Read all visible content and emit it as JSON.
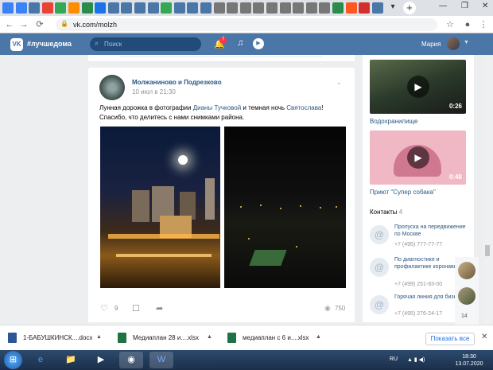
{
  "browser": {
    "url": "vk.com/molzh",
    "new_tab": "+",
    "tab_dropdown": "▾",
    "window_buttons": {
      "minimize": "—",
      "maximize": "❐",
      "close": "✕"
    },
    "tab_colors": [
      "#3b82f6",
      "#3b82f6",
      "#4a76a8",
      "#ea4335",
      "#34a853",
      "#ff8c00",
      "#2a8c4a",
      "#1a73e8",
      "#4a76a8",
      "#4a76a8",
      "#4a76a8",
      "#4a76a8",
      "#34a853",
      "#4a76a8",
      "#4a76a8",
      "#4a76a8",
      "#777777",
      "#777777",
      "#777777",
      "#777777",
      "#777777",
      "#777777",
      "#777777",
      "#777777",
      "#777777",
      "#2a8c4a",
      "#ff5722",
      "#d32f2f",
      "#4a76a8"
    ]
  },
  "vk_header": {
    "logo": "VK",
    "hashtag": "#лучшедома",
    "search_placeholder": "Поиск",
    "notifications_count": "7",
    "user_name": "Мария"
  },
  "post": {
    "group_name": "Молжаниново и Подрезково",
    "date": "10 июл в 21:30",
    "text_before": "Лунная дорожка в фотографии ",
    "author_link": "Дианы Тучковой",
    "text_mid": " и темная ночь ",
    "author_link2": "Святослава",
    "text_after": "! Спасибо, что делитесь с нами снимками района.",
    "likes": "9",
    "views": "750"
  },
  "sidebar": {
    "videos": [
      {
        "title": "Водохранилище",
        "duration": "0:26"
      },
      {
        "title": "Приют \"Супер собака\"",
        "duration": "0:48"
      }
    ],
    "contacts_title": "Контакты",
    "contacts_count": "4",
    "contacts": [
      {
        "name": "Пропуска на передвижение по Москве",
        "phone": "+7 (495) 777-77-77"
      },
      {
        "name": "По диагностике и профилактике коронавируса",
        "phone": "+7 (499) 251-83-00"
      },
      {
        "name": "Горячая линия для бизнеса",
        "phone": "+7 (495) 276-24-17"
      }
    ]
  },
  "chat": {
    "count": "14"
  },
  "downloads": {
    "items": [
      {
        "name": "1-БАБУШКИНСК....docx",
        "type": "word"
      },
      {
        "name": "Медиаплан 28 и....xlsx",
        "type": "excel"
      },
      {
        "name": "медиаплан с 6 и....xlsx",
        "type": "excel"
      }
    ],
    "show_all": "Показать все"
  },
  "taskbar": {
    "lang": "RU",
    "time": "18:30",
    "date": "13.07.2020"
  }
}
